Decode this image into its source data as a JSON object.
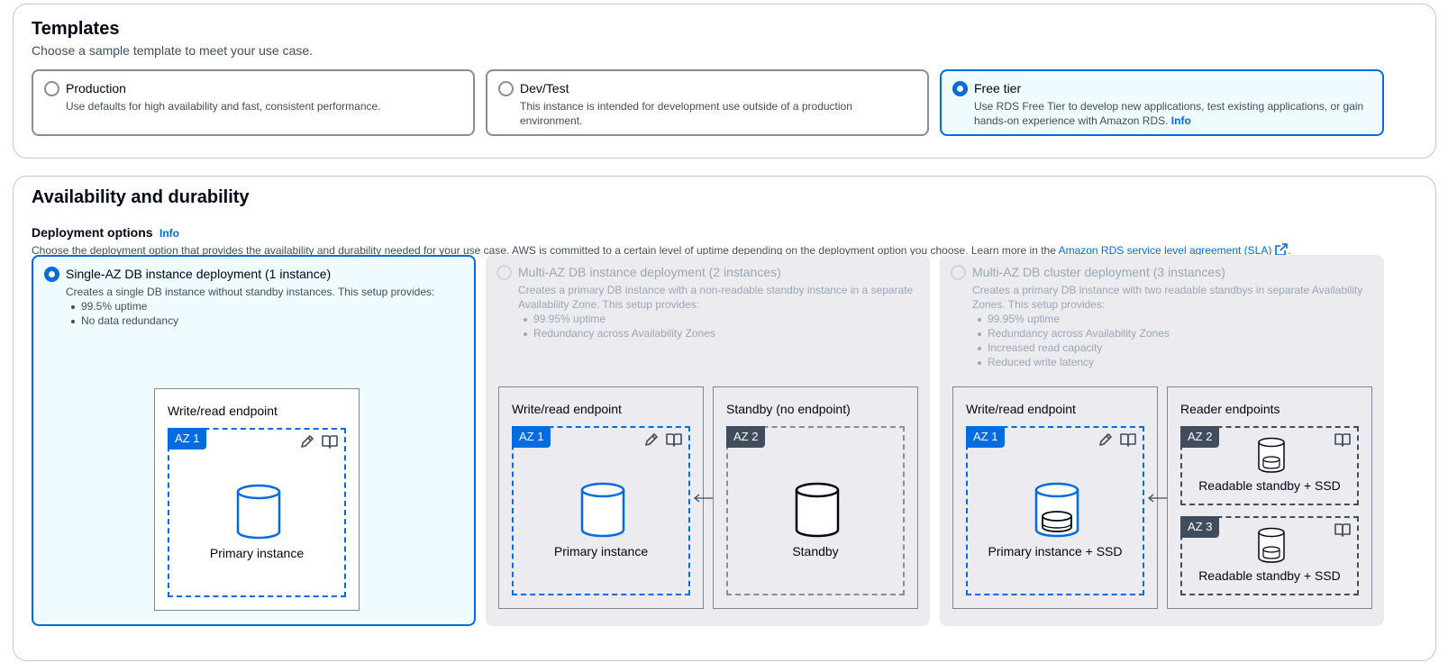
{
  "templates": {
    "title": "Templates",
    "description": "Choose a sample template to meet your use case.",
    "options": [
      {
        "label": "Production",
        "description": "Use defaults for high availability and fast, consistent performance.",
        "selected": false
      },
      {
        "label": "Dev/Test",
        "description": "This instance is intended for development use outside of a production environment.",
        "selected": false
      },
      {
        "label": "Free tier",
        "description": "Use RDS Free Tier to develop new applications, test existing applications, or gain hands-on experience with Amazon RDS.",
        "info": "Info",
        "selected": true
      }
    ]
  },
  "availability": {
    "title": "Availability and durability",
    "deployment_label": "Deployment options",
    "deployment_info": "Info",
    "description": "Choose the deployment option that provides the availability and durability needed for your use case. AWS is committed to a certain level of uptime depending on the deployment option you choose. Learn more in the",
    "sla_link": "Amazon RDS service level agreement (SLA)",
    "description_end": ".",
    "options": [
      {
        "label": "Single-AZ DB instance deployment (1 instance)",
        "description": "Creates a single DB instance without standby instances. This setup provides:",
        "bullets": [
          "99.5% uptime",
          "No data redundancy"
        ],
        "selected": true,
        "disabled": false
      },
      {
        "label": "Multi-AZ DB instance deployment (2 instances)",
        "description": "Creates a primary DB instance with a non-readable standby instance in a separate Availability Zone. This setup provides:",
        "bullets": [
          "99.95% uptime",
          "Redundancy across Availability Zones"
        ],
        "selected": false,
        "disabled": true
      },
      {
        "label": "Multi-AZ DB cluster deployment (3 instances)",
        "description": "Creates a primary DB instance with two readable standbys in separate Availability Zones. This setup provides:",
        "bullets": [
          "99.95% uptime",
          "Redundancy across Availability Zones",
          "Increased read capacity",
          "Reduced write latency"
        ],
        "selected": false,
        "disabled": true
      }
    ],
    "diagrams": {
      "single": {
        "endpoint": "Write/read endpoint",
        "az": "AZ 1",
        "instance": "Primary instance"
      },
      "multi_instance": {
        "endpoint": "Write/read endpoint",
        "az1": "AZ 1",
        "primary": "Primary instance",
        "standby_endpoint": "Standby (no endpoint)",
        "az2": "AZ 2",
        "standby": "Standby"
      },
      "multi_cluster": {
        "endpoint": "Write/read endpoint",
        "az1": "AZ 1",
        "primary": "Primary instance + SSD",
        "reader_endpoints": "Reader endpoints",
        "az2": "AZ 2",
        "az3": "AZ 3",
        "readable1": "Readable standby + SSD",
        "readable2": "Readable standby + SSD"
      }
    }
  },
  "colors": {
    "accent": "#006ce0",
    "selected_bg": "#f0fbff",
    "disabled_bg": "#ebebf0",
    "border": "#8c8c94",
    "dark_badge": "#414d5c"
  }
}
